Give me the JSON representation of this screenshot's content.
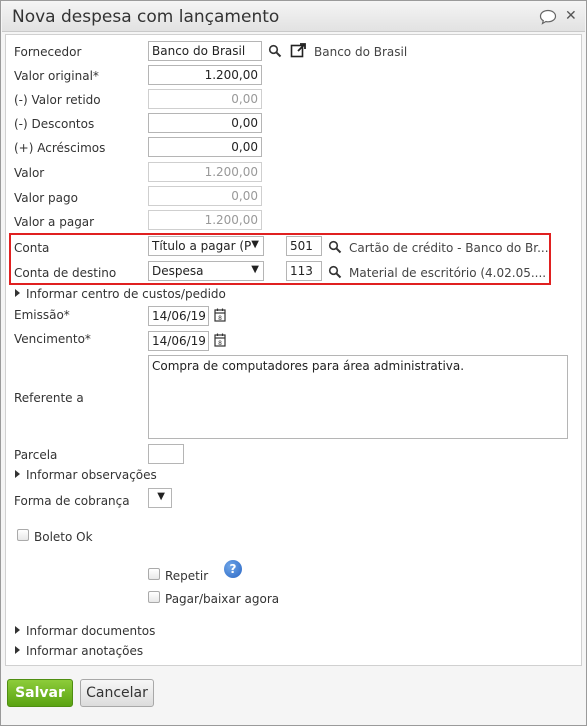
{
  "dialog": {
    "title": "Nova despesa com lançamento"
  },
  "form": {
    "fornecedor_label": "Fornecedor",
    "fornecedor_value": "Banco do Brasil",
    "fornecedor_link": "Banco do Brasil",
    "valor_original_label": "Valor original*",
    "valor_original_value": "1.200,00",
    "valor_retido_label": "(-) Valor retido",
    "valor_retido_value": "0,00",
    "descontos_label": "(-) Descontos",
    "descontos_value": "0,00",
    "acrescimos_label": "(+) Acréscimos",
    "acrescimos_value": "0,00",
    "valor_label": "Valor",
    "valor_value": "1.200,00",
    "valor_pago_label": "Valor pago",
    "valor_pago_value": "0,00",
    "valor_a_pagar_label": "Valor a pagar",
    "valor_a_pagar_value": "1.200,00",
    "conta_label": "Conta",
    "conta_select": "Título a pagar (P",
    "conta_code": "501",
    "conta_desc": "Cartão de crédito - Banco do Br...",
    "conta_destino_label": "Conta de destino",
    "conta_destino_select": "Despesa",
    "conta_destino_code": "113",
    "conta_destino_desc": "Material de escritório (4.02.05....",
    "centro_custos": "Informar centro de custos/pedido",
    "emissao_label": "Emissão*",
    "emissao_value": "14/06/19",
    "vencimento_label": "Vencimento*",
    "vencimento_value": "14/06/19",
    "referente_label": "Referente a",
    "referente_value": "Compra de computadores para área administrativa.",
    "parcela_label": "Parcela",
    "parcela_value": "",
    "observacoes": "Informar observações",
    "forma_cobranca_label": "Forma de cobrança",
    "boleto_label": "Boleto Ok",
    "repetir_label": "Repetir",
    "help_glyph": "?",
    "pagar_label": "Pagar/baixar agora",
    "documentos": "Informar documentos",
    "anotacoes": "Informar anotações"
  },
  "buttons": {
    "save": "Salvar",
    "cancel": "Cancelar"
  },
  "colors": {
    "save_green": "#5aa312",
    "highlight_red": "#e02020",
    "help_blue": "#2a66c4"
  }
}
